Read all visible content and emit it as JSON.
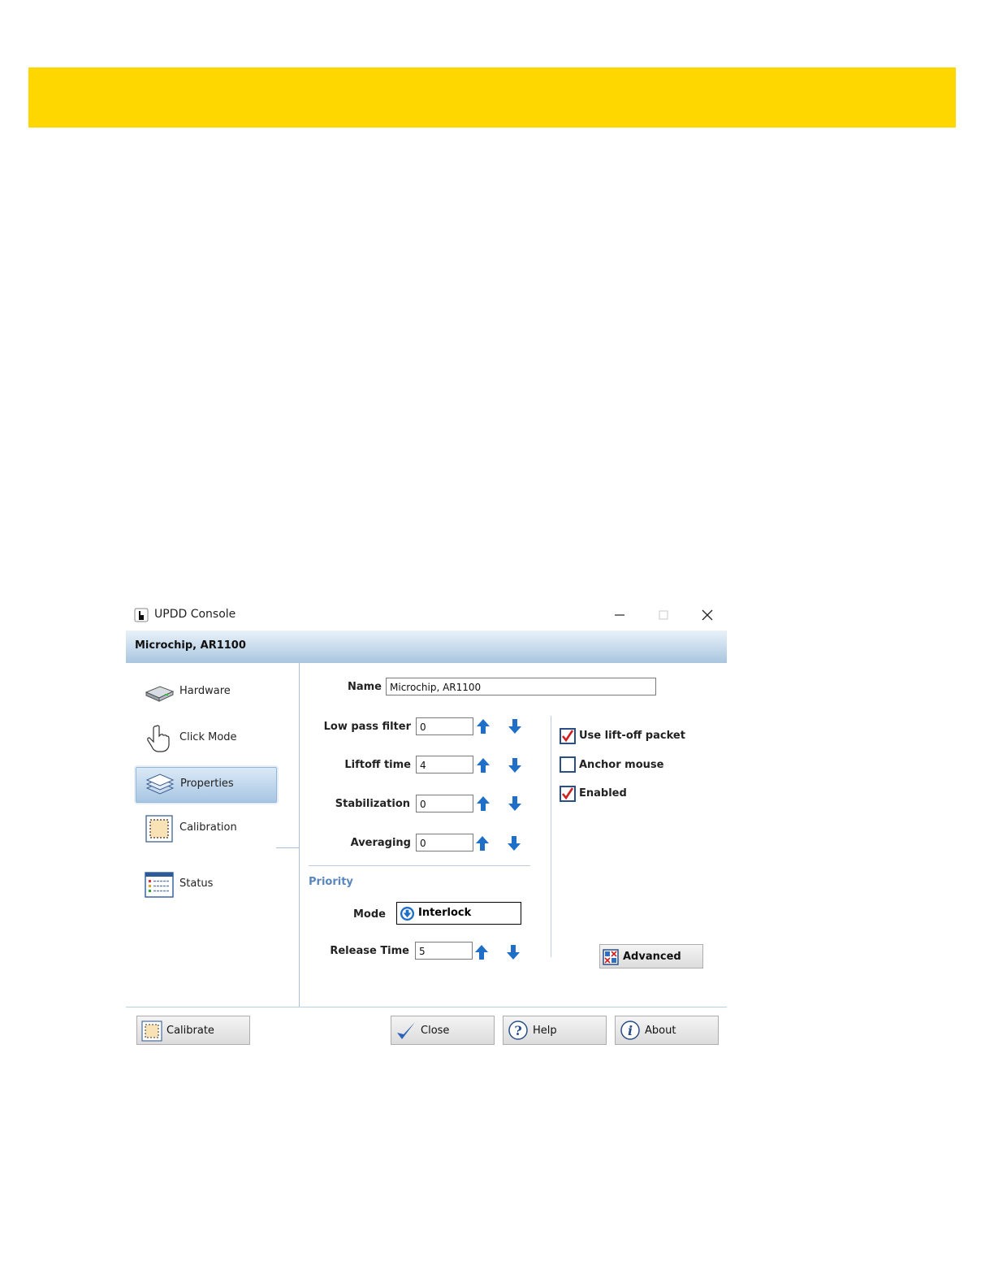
{
  "window": {
    "title": "UPDD Console",
    "device_name": "Microchip, AR1100"
  },
  "nav": {
    "items": [
      {
        "label": "Hardware",
        "icon": "hardware-icon"
      },
      {
        "label": "Click Mode",
        "icon": "hand-pointer-icon"
      },
      {
        "label": "Properties",
        "icon": "layers-icon",
        "active": true
      },
      {
        "label": "Calibration",
        "icon": "calibration-icon"
      },
      {
        "label": "Status",
        "icon": "status-list-icon"
      }
    ]
  },
  "properties": {
    "name_label": "Name",
    "name_value": "Microchip, AR1100",
    "low_pass_filter_label": "Low pass filter",
    "low_pass_filter_value": "0",
    "liftoff_time_label": "Liftoff time",
    "liftoff_time_value": "4",
    "stabilization_label": "Stabilization",
    "stabilization_value": "0",
    "averaging_label": "Averaging",
    "averaging_value": "0",
    "priority_heading": "Priority",
    "mode_label": "Mode",
    "mode_value": "Interlock",
    "release_time_label": "Release Time",
    "release_time_value": "5"
  },
  "options": {
    "use_liftoff_packet": {
      "label": "Use lift-off packet",
      "checked": true
    },
    "anchor_mouse": {
      "label": "Anchor mouse",
      "checked": false
    },
    "enabled": {
      "label": "Enabled",
      "checked": true
    }
  },
  "buttons": {
    "advanced": "Advanced",
    "calibrate": "Calibrate",
    "close": "Close",
    "help": "Help",
    "about": "About"
  },
  "colors": {
    "accent_yellow": "#ffd700",
    "arrow_blue": "#1f6fc9",
    "priority_blue": "#5a86bf",
    "check_red": "#d11f1f"
  }
}
